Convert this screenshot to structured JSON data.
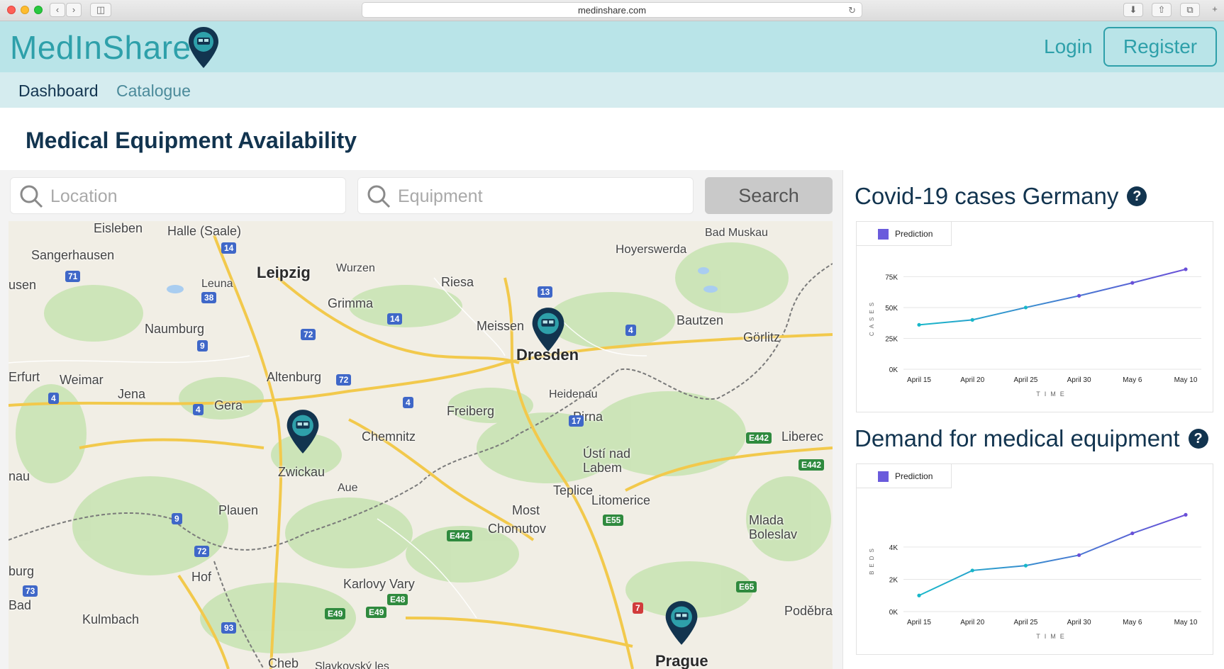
{
  "browser": {
    "url": "medinshare.com"
  },
  "header": {
    "logo_text": "MedInShare",
    "login_label": "Login",
    "register_label": "Register"
  },
  "nav": {
    "items": [
      {
        "label": "Dashboard"
      },
      {
        "label": "Catalogue"
      }
    ]
  },
  "page": {
    "title": "Medical Equipment Availability"
  },
  "search": {
    "location_placeholder": "Location",
    "equipment_placeholder": "Equipment",
    "button_label": "Search"
  },
  "map": {
    "cities": [
      {
        "name": "Eisleben"
      },
      {
        "name": "Halle (Saale)"
      },
      {
        "name": "Sangerhausen"
      },
      {
        "name": "Leipzig"
      },
      {
        "name": "Wurzen"
      },
      {
        "name": "Leuna"
      },
      {
        "name": "Grimma"
      },
      {
        "name": "Riesa"
      },
      {
        "name": "Meissen"
      },
      {
        "name": "Dresden"
      },
      {
        "name": "Naumburg"
      },
      {
        "name": "Weimar"
      },
      {
        "name": "Erfurt"
      },
      {
        "name": "Jena"
      },
      {
        "name": "Altenburg"
      },
      {
        "name": "Gera"
      },
      {
        "name": "Chemnitz"
      },
      {
        "name": "Freiberg"
      },
      {
        "name": "Heidenau"
      },
      {
        "name": "Pirna"
      },
      {
        "name": "Zwickau"
      },
      {
        "name": "Bautzen"
      },
      {
        "name": "Görlitz"
      },
      {
        "name": "Hoyerswerda"
      },
      {
        "name": "Bad Muskau"
      },
      {
        "name": "Liberec"
      },
      {
        "name": "Ústí nad Labem"
      },
      {
        "name": "Teplice"
      },
      {
        "name": "Litomerice"
      },
      {
        "name": "Most"
      },
      {
        "name": "Chomutov"
      },
      {
        "name": "Aue"
      },
      {
        "name": "Plauen"
      },
      {
        "name": "Hof"
      },
      {
        "name": "Karlovy Vary"
      },
      {
        "name": "Mlada Boleslav"
      },
      {
        "name": "Prague"
      },
      {
        "name": "Poděbra"
      },
      {
        "name": "Kulmbach"
      },
      {
        "name": "Cheb"
      },
      {
        "name": "Bad"
      },
      {
        "name": "burg"
      },
      {
        "name": "nau"
      },
      {
        "name": "usen"
      },
      {
        "name": "Slavkovský les"
      }
    ],
    "roads": [
      "14",
      "71",
      "38",
      "72",
      "9",
      "4",
      "14",
      "13",
      "4",
      "72",
      "4",
      "4",
      "17",
      "9",
      "72",
      "73",
      "93",
      "E442",
      "E442",
      "E55",
      "E442",
      "E65",
      "E49",
      "E49",
      "E48",
      "7"
    ],
    "markers": [
      {
        "icon": "ambulance-pin-icon"
      },
      {
        "icon": "ambulance-pin-icon"
      },
      {
        "icon": "ambulance-pin-icon"
      }
    ]
  },
  "charts": {
    "cases_title": "Covid-19 cases Germany",
    "demand_title": "Demand for medical equipment",
    "help_icon": "?"
  },
  "chart_data": [
    {
      "type": "line",
      "title": "Covid-19 cases Germany",
      "xlabel": "TIME",
      "ylabel": "CASES",
      "categories": [
        "April 15",
        "April 20",
        "April 25",
        "April 30",
        "May 6",
        "May 10"
      ],
      "y_ticks": [
        "0K",
        "25K",
        "50K",
        "75K"
      ],
      "ylim": [
        0,
        85000
      ],
      "series": [
        {
          "name": "Prediction",
          "x": [
            0,
            1,
            2,
            3,
            4,
            5
          ],
          "values": [
            36000,
            40000,
            50000,
            59500,
            70000,
            81000
          ]
        }
      ],
      "colors": {
        "start": "#17b7c9",
        "end": "#6a4fd8"
      },
      "grid": true,
      "legend_position": "top-left"
    },
    {
      "type": "line",
      "title": "Demand for medical equipment",
      "xlabel": "TIME",
      "ylabel": "BEDS",
      "categories": [
        "April 15",
        "April 20",
        "April 25",
        "April 30",
        "May 6",
        "May 10"
      ],
      "y_ticks": [
        "0K",
        "2K",
        "4K"
      ],
      "ylim": [
        0,
        6500
      ],
      "series": [
        {
          "name": "Prediction",
          "x": [
            0,
            1,
            2,
            3,
            4,
            5
          ],
          "values": [
            1000,
            2550,
            2850,
            3500,
            4850,
            6000
          ]
        }
      ],
      "colors": {
        "start": "#17b7c9",
        "end": "#6a4fd8"
      },
      "grid": true,
      "legend_position": "top-left"
    }
  ]
}
